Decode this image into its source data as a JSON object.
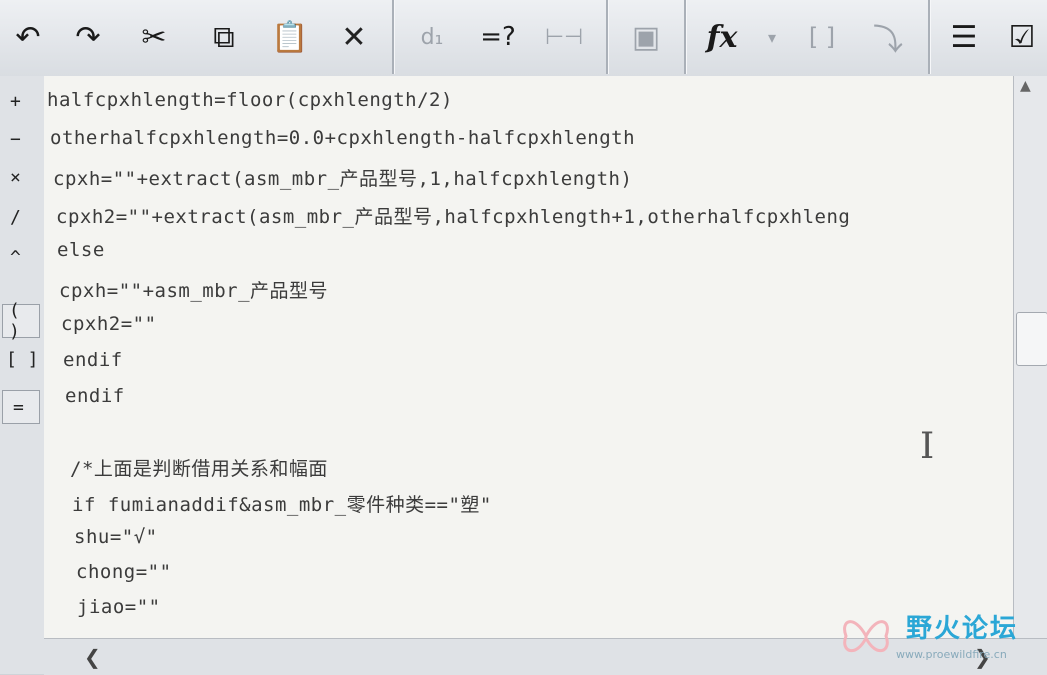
{
  "toolbar": {
    "buttons": [
      {
        "name": "undo-button",
        "icon": "undo-icon",
        "glyph": "↶",
        "enabled": true
      },
      {
        "name": "redo-button",
        "icon": "redo-icon",
        "glyph": "↷",
        "enabled": true
      },
      {
        "name": "cut-button",
        "icon": "scissors-icon",
        "glyph": "✂",
        "enabled": true
      },
      {
        "name": "copy-button",
        "icon": "copy-icon",
        "glyph": "⧉",
        "enabled": true
      },
      {
        "name": "paste-button",
        "icon": "clipboard-icon",
        "glyph": "📋",
        "enabled": true
      },
      {
        "name": "delete-button",
        "icon": "close-icon",
        "glyph": "✕",
        "enabled": true
      },
      {
        "name": "insert-dimension-button",
        "icon": "dimension-icon",
        "glyph": "d₁",
        "enabled": false
      },
      {
        "name": "evaluate-button",
        "icon": "evaluate-icon",
        "glyph": "=?",
        "enabled": true
      },
      {
        "name": "measure-button",
        "icon": "measure-icon",
        "glyph": "⊢⊣",
        "enabled": false
      },
      {
        "name": "insert-parameter-button",
        "icon": "parameter-icon",
        "glyph": "▣",
        "enabled": false
      },
      {
        "name": "insert-function-button",
        "icon": "function-icon",
        "glyph": "fx",
        "enabled": true
      },
      {
        "name": "insert-brackets-button",
        "icon": "brackets-icon",
        "glyph": "[ ]",
        "enabled": false
      },
      {
        "name": "select-button",
        "icon": "select-icon",
        "glyph": "⤵",
        "enabled": false
      },
      {
        "name": "view-list-button",
        "icon": "list-icon",
        "glyph": "☰",
        "enabled": true
      },
      {
        "name": "verify-button",
        "icon": "checklist-icon",
        "glyph": "☑",
        "enabled": true
      }
    ]
  },
  "operators": [
    {
      "label": "+",
      "boxed": false
    },
    {
      "label": "−",
      "boxed": false
    },
    {
      "label": "×",
      "boxed": false
    },
    {
      "label": "/",
      "boxed": false
    },
    {
      "label": "^",
      "boxed": false
    },
    {
      "label": "( )",
      "boxed": true
    },
    {
      "label": "[ ]",
      "boxed": false
    },
    {
      "label": "=",
      "boxed": true
    }
  ],
  "code_lines": [
    "halfcpxhlength=floor(cpxhlength/2)",
    "otherhalfcpxhlength=0.0+cpxhlength-halfcpxhlength",
    "cpxh=\"\"+extract(asm_mbr_产品型号,1,halfcpxhlength)",
    "cpxh2=\"\"+extract(asm_mbr_产品型号,halfcpxhlength+1,otherhalfcpxhleng",
    "else",
    "cpxh=\"\"+asm_mbr_产品型号",
    "cpxh2=\"\"",
    "endif",
    "endif",
    "",
    "/*上面是判断借用关系和幅面",
    "if fumianaddif&asm_mbr_零件种类==\"塑\"",
    "shu=\"√\"",
    "chong=\"\"",
    "jiao=\"\""
  ],
  "watermark": {
    "text": "野火论坛",
    "sub": "www.proewildfire.cn"
  }
}
